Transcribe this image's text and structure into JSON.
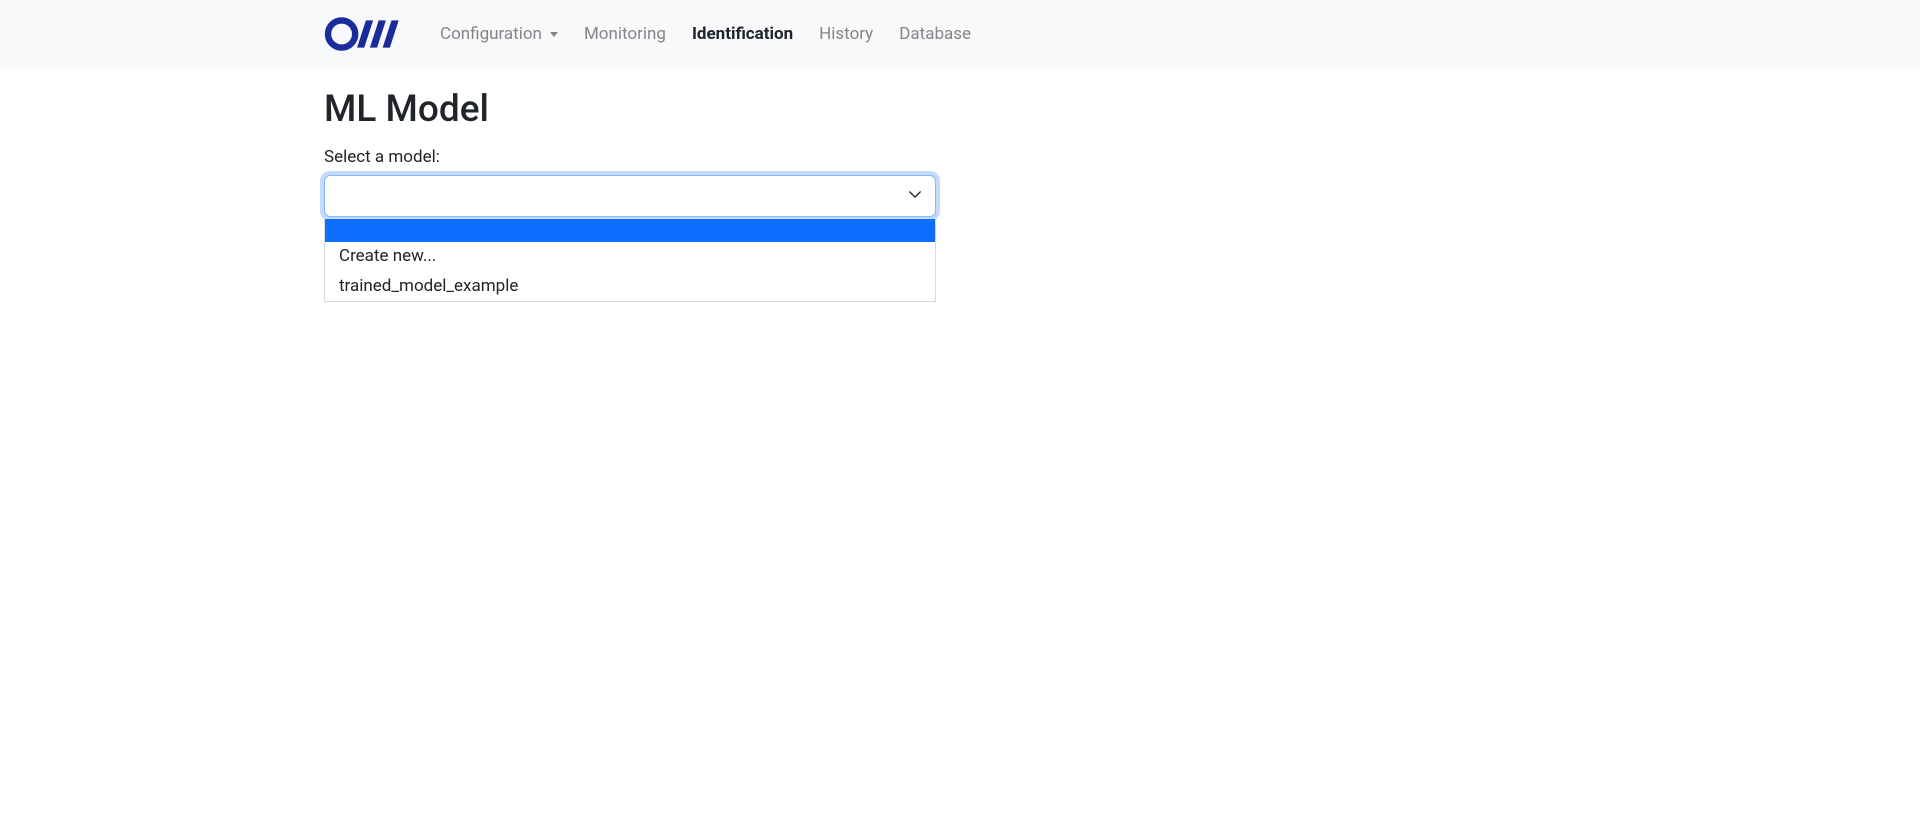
{
  "nav": {
    "items": [
      {
        "label": "Configuration",
        "hasDropdown": true,
        "active": false
      },
      {
        "label": "Monitoring",
        "hasDropdown": false,
        "active": false
      },
      {
        "label": "Identification",
        "hasDropdown": false,
        "active": true
      },
      {
        "label": "History",
        "hasDropdown": false,
        "active": false
      },
      {
        "label": "Database",
        "hasDropdown": false,
        "active": false
      }
    ]
  },
  "page": {
    "title": "ML Model",
    "select_label": "Select a model:"
  },
  "model_select": {
    "value": "",
    "options": [
      {
        "label": "",
        "highlighted": true
      },
      {
        "label": "Create new...",
        "highlighted": false
      },
      {
        "label": "trained_model_example",
        "highlighted": false
      }
    ]
  },
  "colors": {
    "brand": "#1a2c9b",
    "focus_ring": "rgba(13,110,253,0.25)",
    "highlight": "#0d6efd"
  }
}
